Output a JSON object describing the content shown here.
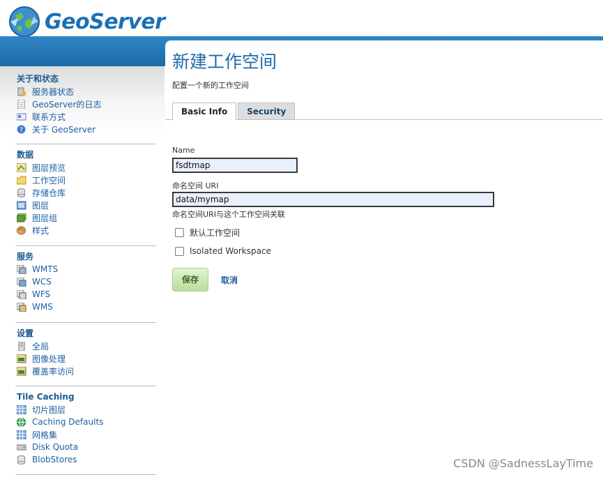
{
  "app": {
    "name": "GeoServer"
  },
  "sidebar": {
    "sections": [
      {
        "title": "关于和状态",
        "items": [
          {
            "label": "服务器状态",
            "icon": "server-status-icon"
          },
          {
            "label": "GeoServer的日志",
            "icon": "log-file-icon"
          },
          {
            "label": "联系方式",
            "icon": "contact-card-icon"
          },
          {
            "label": "关于 GeoServer",
            "icon": "info-icon"
          }
        ]
      },
      {
        "title": "数据",
        "items": [
          {
            "label": "图层预览",
            "icon": "layer-preview-icon"
          },
          {
            "label": "工作空间",
            "icon": "folder-icon"
          },
          {
            "label": "存储仓库",
            "icon": "database-icon"
          },
          {
            "label": "图层",
            "icon": "layer-icon"
          },
          {
            "label": "图层组",
            "icon": "layer-group-icon"
          },
          {
            "label": "样式",
            "icon": "palette-icon"
          }
        ]
      },
      {
        "title": "服务",
        "items": [
          {
            "label": "WMTS",
            "icon": "service-icon"
          },
          {
            "label": "WCS",
            "icon": "service-icon"
          },
          {
            "label": "WFS",
            "icon": "service-icon"
          },
          {
            "label": "WMS",
            "icon": "service-icon"
          }
        ]
      },
      {
        "title": "设置",
        "items": [
          {
            "label": "全局",
            "icon": "server-icon"
          },
          {
            "label": "图像处理",
            "icon": "image-icon"
          },
          {
            "label": "覆盖率访问",
            "icon": "image-icon"
          }
        ]
      },
      {
        "title": "Tile Caching",
        "items": [
          {
            "label": "切片图层",
            "icon": "grid-icon"
          },
          {
            "label": "Caching Defaults",
            "icon": "globe-icon"
          },
          {
            "label": "网格集",
            "icon": "grid-icon"
          },
          {
            "label": "Disk Quota",
            "icon": "disk-icon"
          },
          {
            "label": "BlobStores",
            "icon": "blobstore-icon"
          }
        ]
      }
    ]
  },
  "main": {
    "title": "新建工作空间",
    "description": "配置一个新的工作空间",
    "tabs": [
      {
        "label": "Basic Info"
      },
      {
        "label": "Security"
      }
    ],
    "form": {
      "name_label": "Name",
      "name_value": "fsdtmap",
      "uri_label": "命名空间 URI",
      "uri_value": "data/mymap",
      "uri_hint": "命名空间URI与这个工作空间关联",
      "default_ws_label": "默认工作空间",
      "isolated_label": "Isolated Workspace",
      "save_label": "保存",
      "cancel_label": "取消"
    }
  },
  "watermark": "CSDN @SadnessLayTime",
  "colors": {
    "header_band": "#1a6aa6",
    "link": "#1b5fa0",
    "title": "#1c6aa9"
  }
}
